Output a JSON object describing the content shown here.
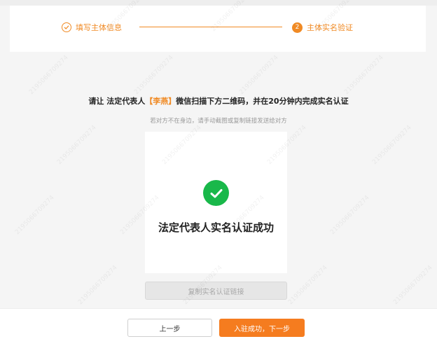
{
  "steps": {
    "step1_label": "填写主体信息",
    "step2_number": "2",
    "step2_label": "主体实名验证"
  },
  "instruction": {
    "prefix": "请让 法定代表人",
    "name": "【李燕】",
    "suffix": "微信扫描下方二维码，并在20分钟内完成实名认证"
  },
  "hint": "若对方不在身边，请手动截图或复制链接发送给对方",
  "result": {
    "text": "法定代表人实名认证成功"
  },
  "copy_button": "复制实名认证链接",
  "footer": {
    "prev_label": "上一步",
    "next_label": "入驻成功，下一步"
  },
  "watermark": "2195066709274",
  "colors": {
    "accent": "#f08a24",
    "success": "#19b84a"
  }
}
